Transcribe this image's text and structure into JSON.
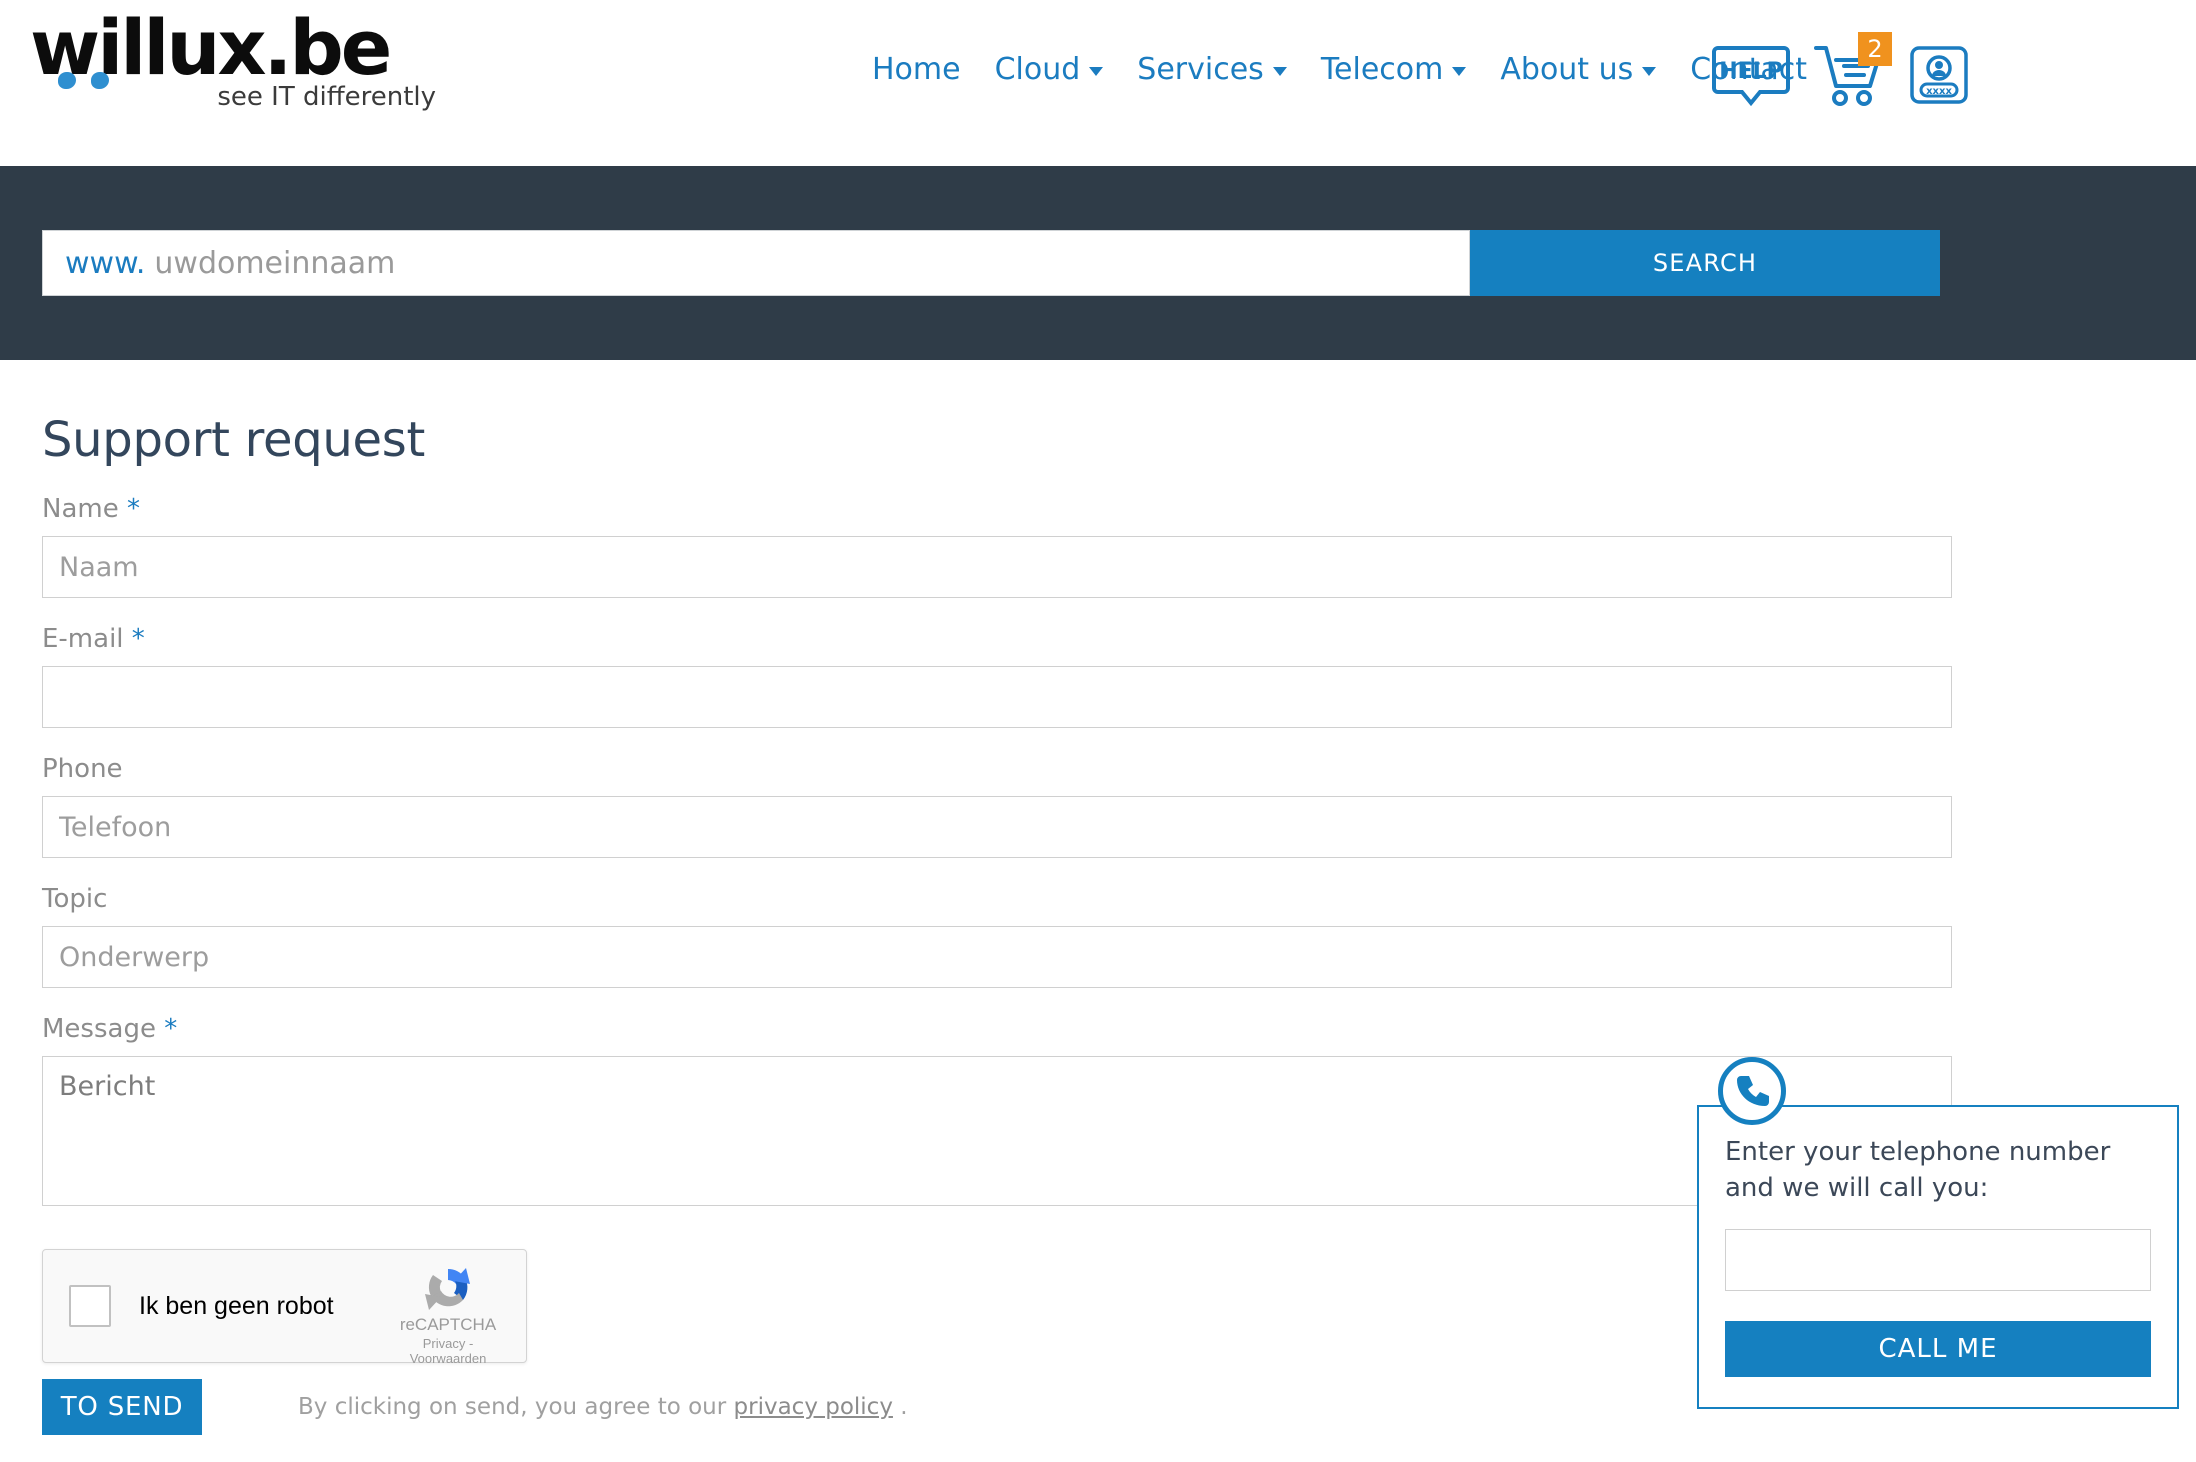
{
  "brand": {
    "logo_text": "willux.be",
    "tagline": "see IT differently"
  },
  "nav": {
    "items": [
      {
        "label": "Home",
        "has_dropdown": false
      },
      {
        "label": "Cloud",
        "has_dropdown": true
      },
      {
        "label": "Services",
        "has_dropdown": true
      },
      {
        "label": "Telecom",
        "has_dropdown": true
      },
      {
        "label": "About us",
        "has_dropdown": true
      },
      {
        "label": "Contact",
        "has_dropdown": false
      }
    ]
  },
  "header_icons": {
    "help_label": "HELP",
    "cart_badge_count": "2",
    "login_mask": "xxxx"
  },
  "domain_search": {
    "prefix": "www.",
    "placeholder": "uwdomeinnaam",
    "value": "",
    "button_label": "SEARCH"
  },
  "form": {
    "title": "Support request",
    "fields": [
      {
        "label": "Name",
        "required_mark": "*",
        "placeholder": "Naam",
        "value": "",
        "type": "text"
      },
      {
        "label": "E-mail",
        "required_mark": "*",
        "placeholder": "",
        "value": "",
        "type": "text"
      },
      {
        "label": "Phone",
        "required_mark": "",
        "placeholder": "Telefoon",
        "value": "",
        "type": "text"
      },
      {
        "label": "Topic",
        "required_mark": "",
        "placeholder": "Onderwerp",
        "value": "",
        "type": "text"
      },
      {
        "label": "Message",
        "required_mark": "*",
        "placeholder": "Bericht",
        "value": "",
        "type": "textarea"
      }
    ],
    "recaptcha": {
      "checkbox_label": "Ik ben geen robot",
      "brand_name": "reCAPTCHA",
      "links": "Privacy - Voorwaarden",
      "checked": false
    },
    "submit_label": "TO SEND",
    "disclaimer_prefix": "By clicking on send, you agree to our ",
    "disclaimer_link": "privacy policy",
    "disclaimer_suffix": " ."
  },
  "callme": {
    "prompt": "Enter your telephone number and we will call you:",
    "input_value": "",
    "button_label": "CALL ME"
  },
  "colors": {
    "accent_blue": "#1580c0",
    "link_blue": "#1b7cc0",
    "dark_band": "#2f3c48",
    "title_slate": "#33465c",
    "badge_orange": "#f0921e"
  }
}
